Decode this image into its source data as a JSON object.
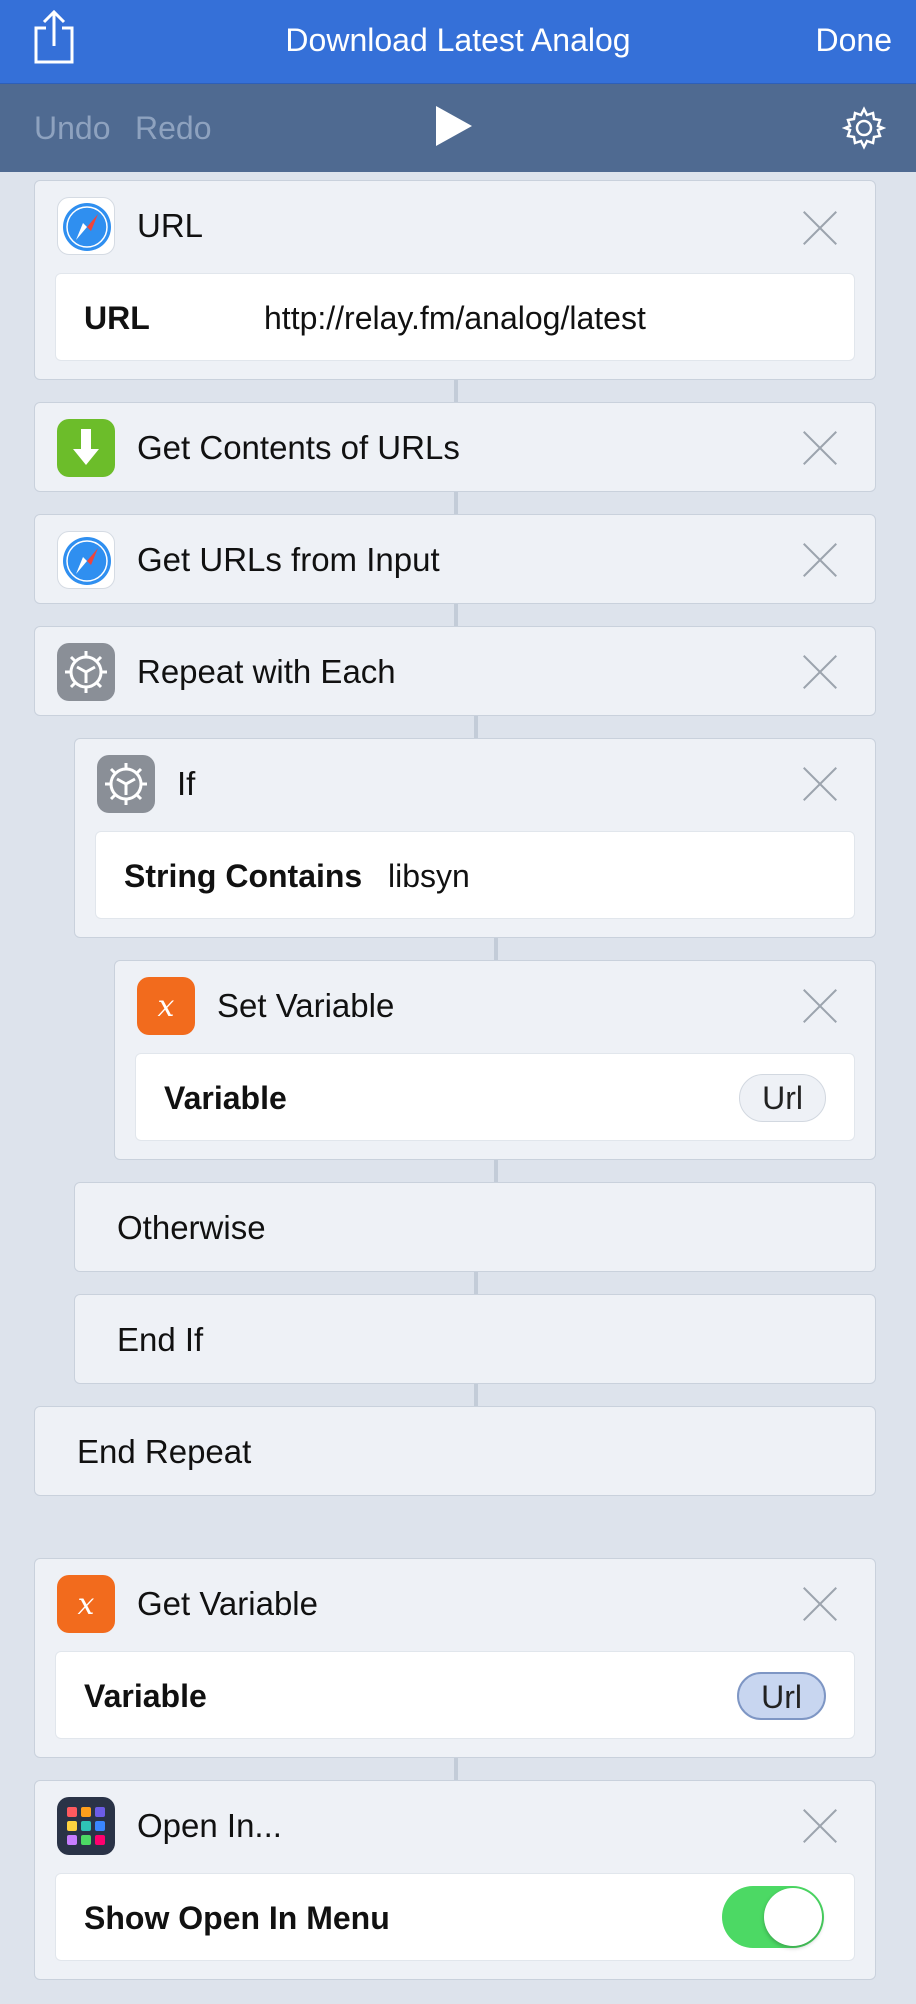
{
  "nav": {
    "title": "Download Latest Analog",
    "done": "Done"
  },
  "toolbar": {
    "undo": "Undo",
    "redo": "Redo"
  },
  "actions": {
    "url": {
      "title": "URL",
      "param_label": "URL",
      "param_value": "http://relay.fm/analog/latest"
    },
    "get_contents": {
      "title": "Get Contents of URLs"
    },
    "get_urls": {
      "title": "Get URLs from Input"
    },
    "repeat": {
      "title": "Repeat with Each"
    },
    "if": {
      "title": "If",
      "param_label": "String Contains",
      "param_value": "libsyn"
    },
    "set_variable": {
      "title": "Set Variable",
      "param_label": "Variable",
      "param_value": "Url"
    },
    "otherwise": {
      "title": "Otherwise"
    },
    "end_if": {
      "title": "End If"
    },
    "end_repeat": {
      "title": "End Repeat"
    },
    "get_variable": {
      "title": "Get Variable",
      "param_label": "Variable",
      "param_value": "Url"
    },
    "open_in": {
      "title": "Open In...",
      "param_label": "Show Open In Menu",
      "toggle_on": true
    }
  },
  "colors": {
    "nav": "#3570d8",
    "toolbar": "#4f6a91",
    "toggle_on": "#4cd964",
    "variable_icon": "#f26b1d"
  },
  "icons": [
    "share-icon",
    "play-icon",
    "gear-icon",
    "safari-icon",
    "download-icon",
    "gear-icon",
    "variable-icon",
    "apps-grid-icon",
    "close-icon"
  ]
}
